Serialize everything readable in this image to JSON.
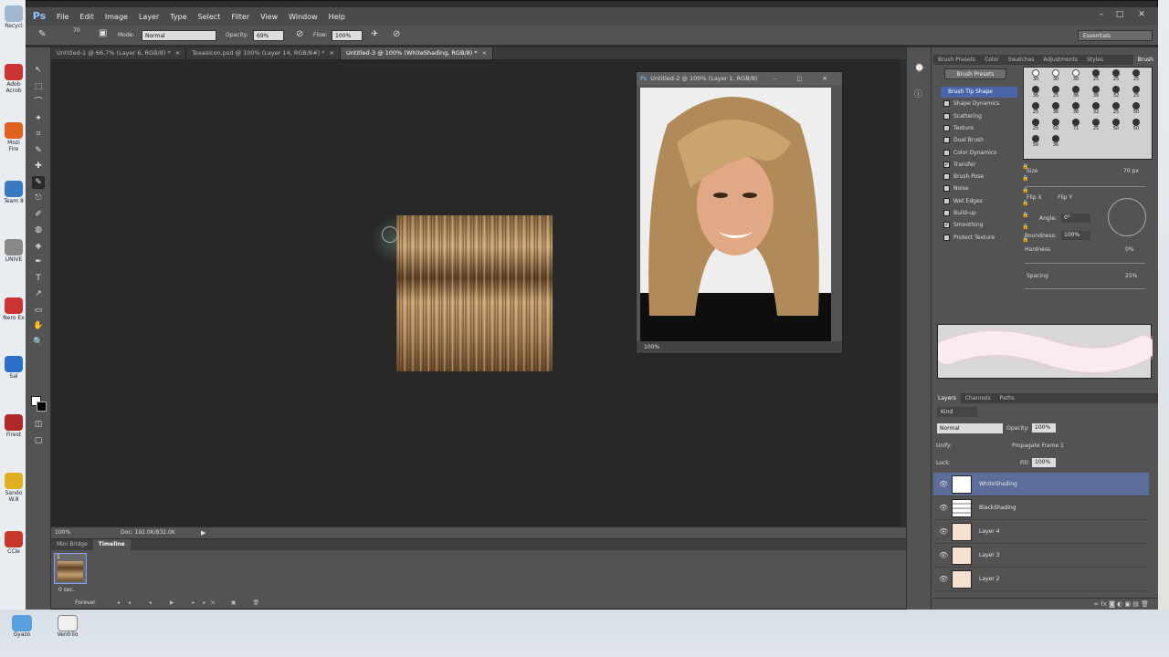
{
  "app": {
    "logo": "Ps"
  },
  "menu": [
    "File",
    "Edit",
    "Image",
    "Layer",
    "Type",
    "Select",
    "Filter",
    "View",
    "Window",
    "Help"
  ],
  "options": {
    "brush_size": "70",
    "mode_label": "Mode:",
    "mode_value": "Normal",
    "opacity_label": "Opacity:",
    "opacity_value": "69%",
    "flow_label": "Flow:",
    "flow_value": "100%",
    "workspace": "Essentials"
  },
  "tabs": [
    {
      "label": "Untitled-1 @ 66.7% (Layer 6, RGB/8) *"
    },
    {
      "label": "TexasIcon.psd @ 100% (Layer 14, RGB/8#) *"
    },
    {
      "label": "Untitled-3 @ 100% (WhiteShading, RGB/8) *"
    }
  ],
  "float_window": {
    "title": "Untitled-2 @ 100% (Layer 1, RGB/8)",
    "zoom": "100%"
  },
  "status": {
    "zoom": "100%",
    "doc": "Doc: 192.0K/832.0K"
  },
  "timeline": {
    "tabs": [
      "Mini Bridge",
      "Timeline"
    ],
    "frame_num": "1",
    "frame_time": "0 sec.",
    "loop": "Forever"
  },
  "brush_panel": {
    "tabs": [
      "Brush Presets",
      "Color",
      "Swatches",
      "Adjustments",
      "Styles",
      "Brush"
    ],
    "presets_btn": "Brush Presets",
    "options": [
      {
        "label": "Brush Tip Shape",
        "checked": ""
      },
      {
        "label": "Shape Dynamics",
        "checked": ""
      },
      {
        "label": "Scattering",
        "checked": ""
      },
      {
        "label": "Texture",
        "checked": ""
      },
      {
        "label": "Dual Brush",
        "checked": ""
      },
      {
        "label": "Color Dynamics",
        "checked": ""
      },
      {
        "label": "Transfer",
        "checked": "✓"
      },
      {
        "label": "Brush Pose",
        "checked": ""
      },
      {
        "label": "Noise",
        "checked": ""
      },
      {
        "label": "Wet Edges",
        "checked": ""
      },
      {
        "label": "Build-up",
        "checked": ""
      },
      {
        "label": "Smoothing",
        "checked": "✓"
      },
      {
        "label": "Protect Texture",
        "checked": ""
      }
    ],
    "tip_sizes": [
      "30",
      "30",
      "30",
      "25",
      "25",
      "25",
      "36",
      "25",
      "36",
      "36",
      "32",
      "25",
      "25",
      "36",
      "36",
      "32",
      "25",
      "50",
      "25",
      "50",
      "71",
      "25",
      "50",
      "50",
      "50",
      "36"
    ],
    "size_label": "Size",
    "size_value": "70 px",
    "flipx": "Flip X",
    "flipy": "Flip Y",
    "angle_label": "Angle:",
    "angle_value": "0°",
    "round_label": "Roundness:",
    "round_value": "100%",
    "hard_label": "Hardness",
    "hard_value": "0%",
    "spacing_label": "Spacing",
    "spacing_value": "25%"
  },
  "layers_panel": {
    "tabs": [
      "Layers",
      "Channels",
      "Paths"
    ],
    "kind": "Kind",
    "blend": "Normal",
    "opacity_label": "Opacity:",
    "opacity_value": "100%",
    "unify_label": "Unify:",
    "propagate": "Propagate Frame 1",
    "lock_label": "Lock:",
    "fill_label": "Fill:",
    "fill_value": "100%",
    "layers": [
      {
        "name": "WhiteShading",
        "selected": true
      },
      {
        "name": "BlackShading",
        "selected": false
      },
      {
        "name": "Layer 4",
        "selected": false
      },
      {
        "name": "Layer 3",
        "selected": false
      },
      {
        "name": "Layer 2",
        "selected": false
      }
    ]
  },
  "desktop": {
    "icons": [
      "Recycl",
      "Adob Acrob",
      "Mozi Fire",
      "Team 8",
      "UNIVE",
      "Nero Ex",
      "Sal",
      "Firest",
      "Sando W.8",
      "CCle"
    ],
    "taskbar": [
      "Gyazo",
      "Ventrilo"
    ]
  }
}
